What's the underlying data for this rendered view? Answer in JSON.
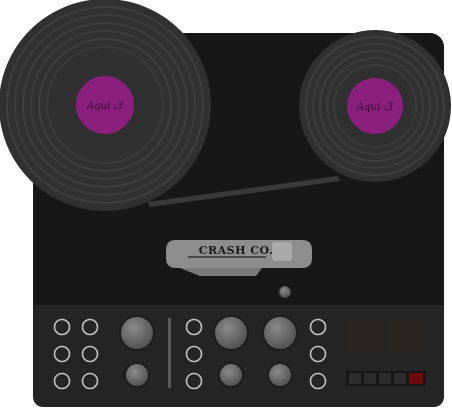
{
  "device": {
    "name": "reel-to-reel tape recorder",
    "colors": {
      "body": "#171717",
      "control_panel": "#252525",
      "reel": "#303030",
      "reel_groove": "#3f3f3f",
      "reel_label": "#8a1f7e",
      "plate": "#8d8d8d",
      "knob": "#6c6c6c",
      "jack_ring": "#c4c4c4",
      "meter": "#2a2520",
      "indicator": "#6e0a0a"
    }
  },
  "reels": {
    "left": {
      "label": "Aqui :3"
    },
    "right": {
      "label": "Aqui :3"
    }
  },
  "head_plate": {
    "brand": "CRASH CO."
  },
  "controls": {
    "level_meters": 2,
    "transport_buttons": 5,
    "active_button": 5
  }
}
